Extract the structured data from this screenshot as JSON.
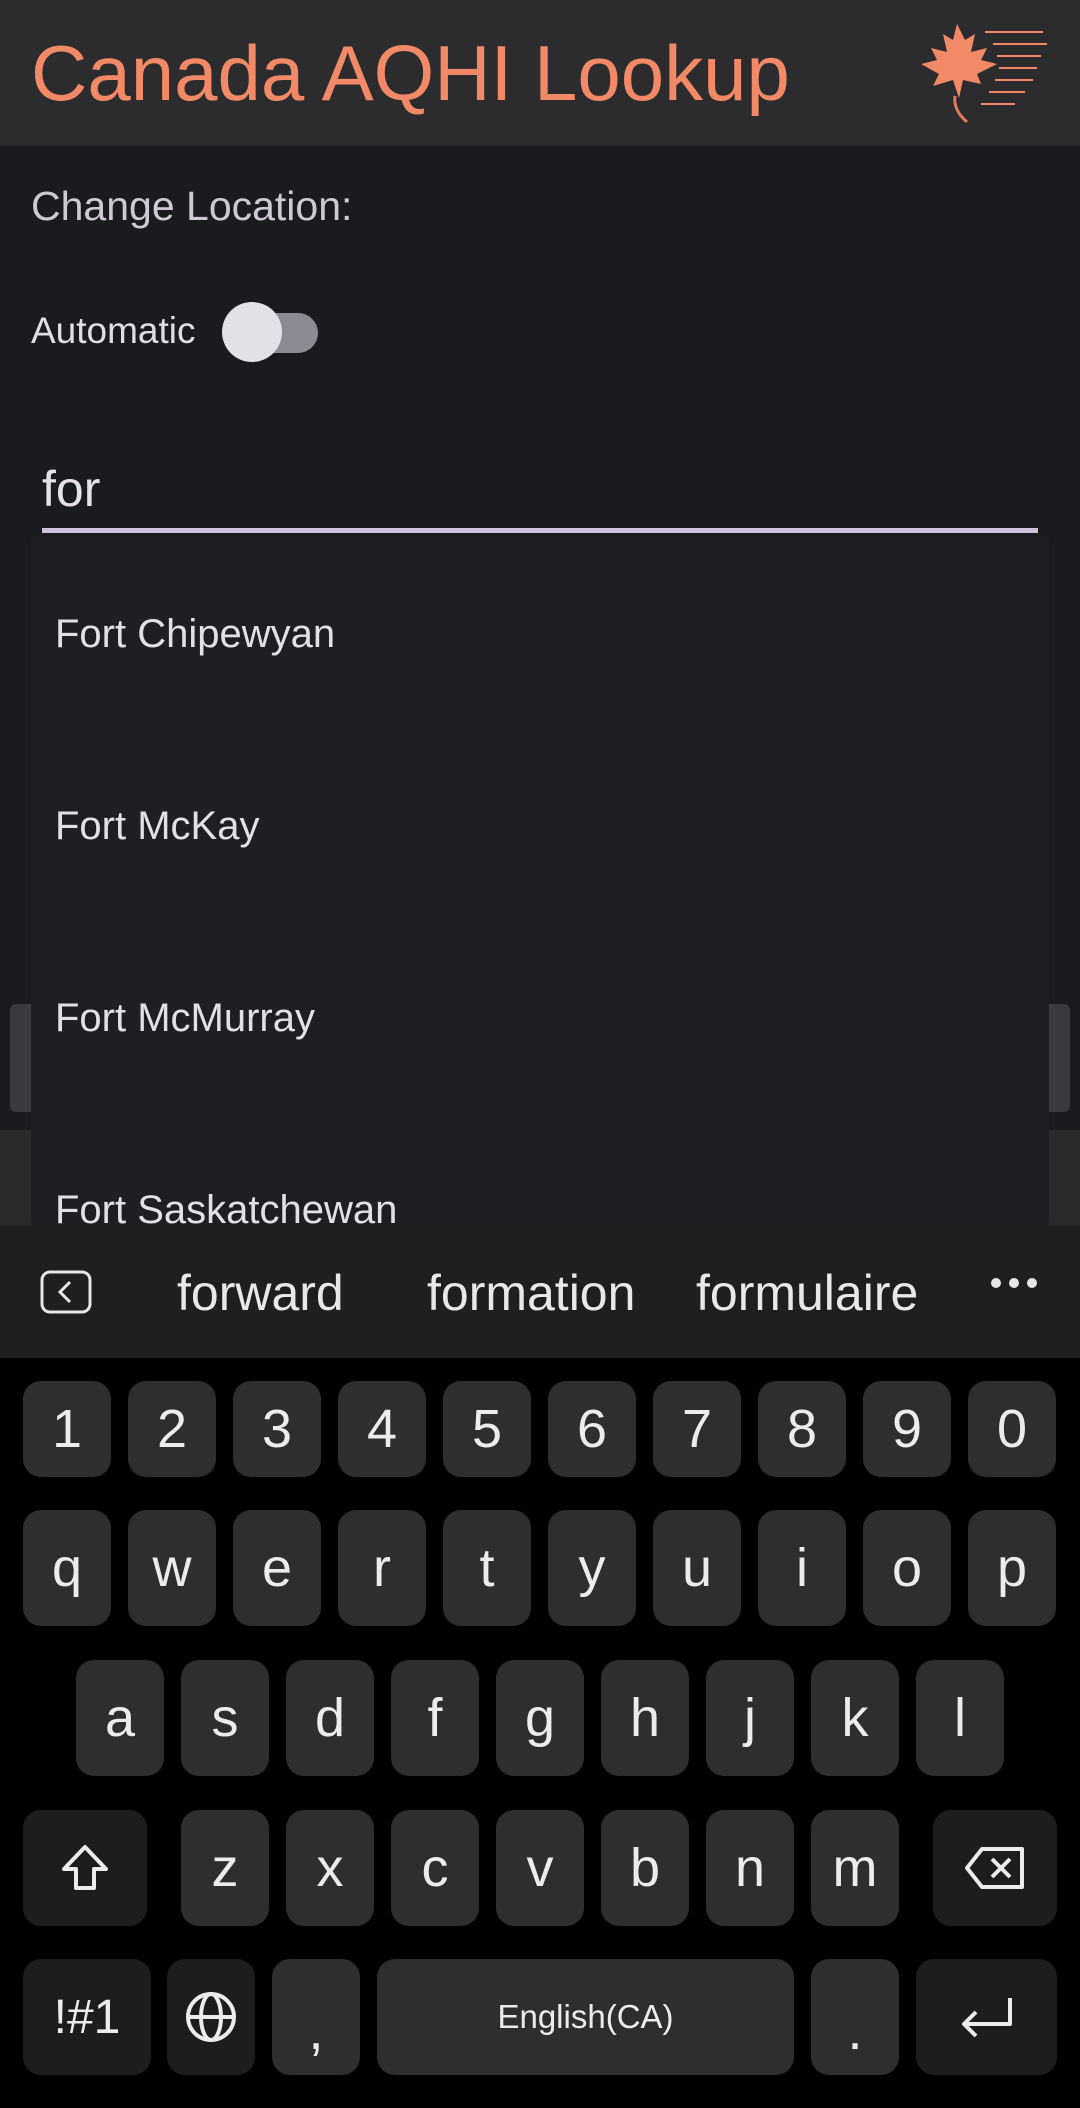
{
  "app": {
    "title": "Canada AQHI Lookup",
    "accent": "#f28a68"
  },
  "location": {
    "section_label": "Change Location:",
    "automatic_label": "Automatic",
    "automatic_enabled": false,
    "search_value": "for"
  },
  "dropdown": {
    "items": [
      "Fort Chipewyan",
      "Fort McKay",
      "Fort McMurray",
      "Fort Saskatchewan"
    ]
  },
  "suggestions": {
    "items": [
      "forward",
      "formation",
      "formulaire"
    ],
    "back_icon": "keyboard-collapse-icon",
    "more_icon": "more-horizontal-icon"
  },
  "keyboard": {
    "row_numbers": [
      "1",
      "2",
      "3",
      "4",
      "5",
      "6",
      "7",
      "8",
      "9",
      "0"
    ],
    "row_1": [
      "q",
      "w",
      "e",
      "r",
      "t",
      "y",
      "u",
      "i",
      "o",
      "p"
    ],
    "row_2": [
      "a",
      "s",
      "d",
      "f",
      "g",
      "h",
      "j",
      "k",
      "l"
    ],
    "row_3": [
      "z",
      "x",
      "c",
      "v",
      "b",
      "n",
      "m"
    ],
    "symbols_label": "!#1",
    "comma": ",",
    "space_label": "English(CA)",
    "period": ".",
    "icons": {
      "shift": "shift-icon",
      "backspace": "backspace-icon",
      "language": "globe-icon",
      "enter": "enter-icon"
    }
  }
}
